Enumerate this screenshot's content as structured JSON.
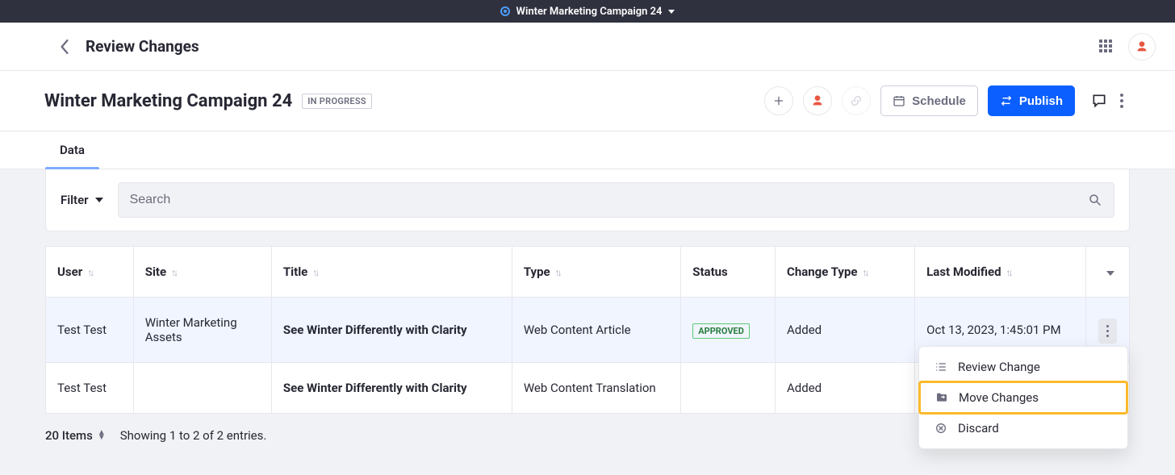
{
  "topbar": {
    "title": "Winter Marketing Campaign 24"
  },
  "breadcrumb": {
    "title": "Review Changes"
  },
  "context": {
    "title": "Winter Marketing Campaign 24",
    "status_badge": "IN PROGRESS",
    "schedule_label": "Schedule",
    "publish_label": "Publish"
  },
  "tabs": {
    "data": "Data"
  },
  "filter": {
    "label": "Filter",
    "search_placeholder": "Search"
  },
  "table": {
    "columns": {
      "user": "User",
      "site": "Site",
      "title": "Title",
      "type": "Type",
      "status": "Status",
      "change_type": "Change Type",
      "last_modified": "Last Modified"
    },
    "rows": [
      {
        "user": "Test Test",
        "site": "Winter Marketing Assets",
        "title": "See Winter Differently with Clarity",
        "type": "Web Content Article",
        "status": "APPROVED",
        "change_type": "Added",
        "last_modified": "Oct 13, 2023, 1:45:01 PM"
      },
      {
        "user": "Test Test",
        "site": "",
        "title": "See Winter Differently with Clarity",
        "type": "Web Content Translation",
        "status": "",
        "change_type": "Added",
        "last_modified": ""
      }
    ]
  },
  "menu": {
    "review": "Review Change",
    "move": "Move Changes",
    "discard": "Discard"
  },
  "footer": {
    "items": "20 Items",
    "showing": "Showing 1 to 2 of 2 entries."
  },
  "colors": {
    "primary": "#0b5fff",
    "highlight": "#fcb92b",
    "approved": "#287d3c"
  }
}
